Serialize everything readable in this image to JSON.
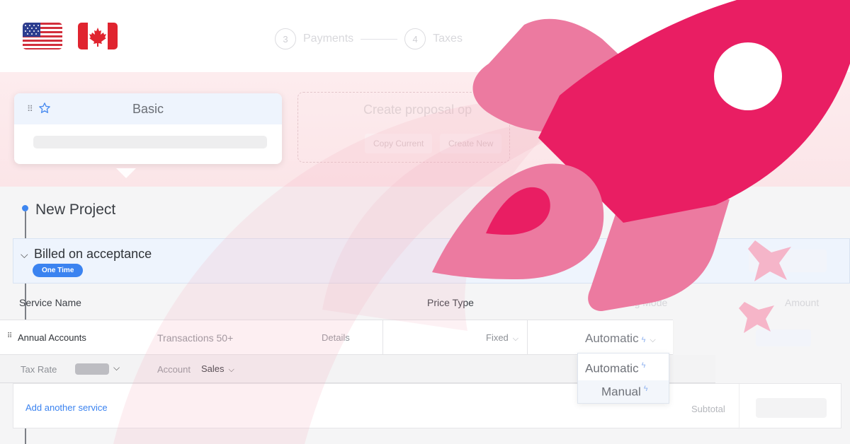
{
  "flags": [
    {
      "name": "us-flag-icon"
    },
    {
      "name": "canada-flag-icon"
    }
  ],
  "steps": [
    {
      "number": "3",
      "label": "Payments"
    },
    {
      "number": "4",
      "label": "Taxes"
    }
  ],
  "proposal_card": {
    "title": "Basic"
  },
  "create_card": {
    "title": "Create proposal op",
    "copy_label": "Copy Current",
    "new_label": "Create New"
  },
  "project": {
    "title": "New Project",
    "billing_title": "Billed on acceptance",
    "billing_badge": "One Time"
  },
  "table": {
    "headers": {
      "service_name": "Service Name",
      "price_type": "Price Type",
      "billing_mode": "Billing Mode",
      "amount": "Amount"
    },
    "row": {
      "service": "Annual Accounts",
      "description": "Transactions 50+",
      "details": "Details",
      "price_type": "Fixed",
      "billing_mode": "Automatic"
    },
    "tax": {
      "tax_rate_label": "Tax Rate",
      "account_label": "Account",
      "account_value": "Sales"
    }
  },
  "dropdown": {
    "options": [
      "Automatic",
      "Manual"
    ]
  },
  "footer": {
    "add_service": "Add another service",
    "subtotal_label": "Subtotal"
  },
  "colors": {
    "rocket_primary": "#e91e63",
    "rocket_secondary": "#ec7aa0",
    "accent_blue": "#3b83f0"
  }
}
